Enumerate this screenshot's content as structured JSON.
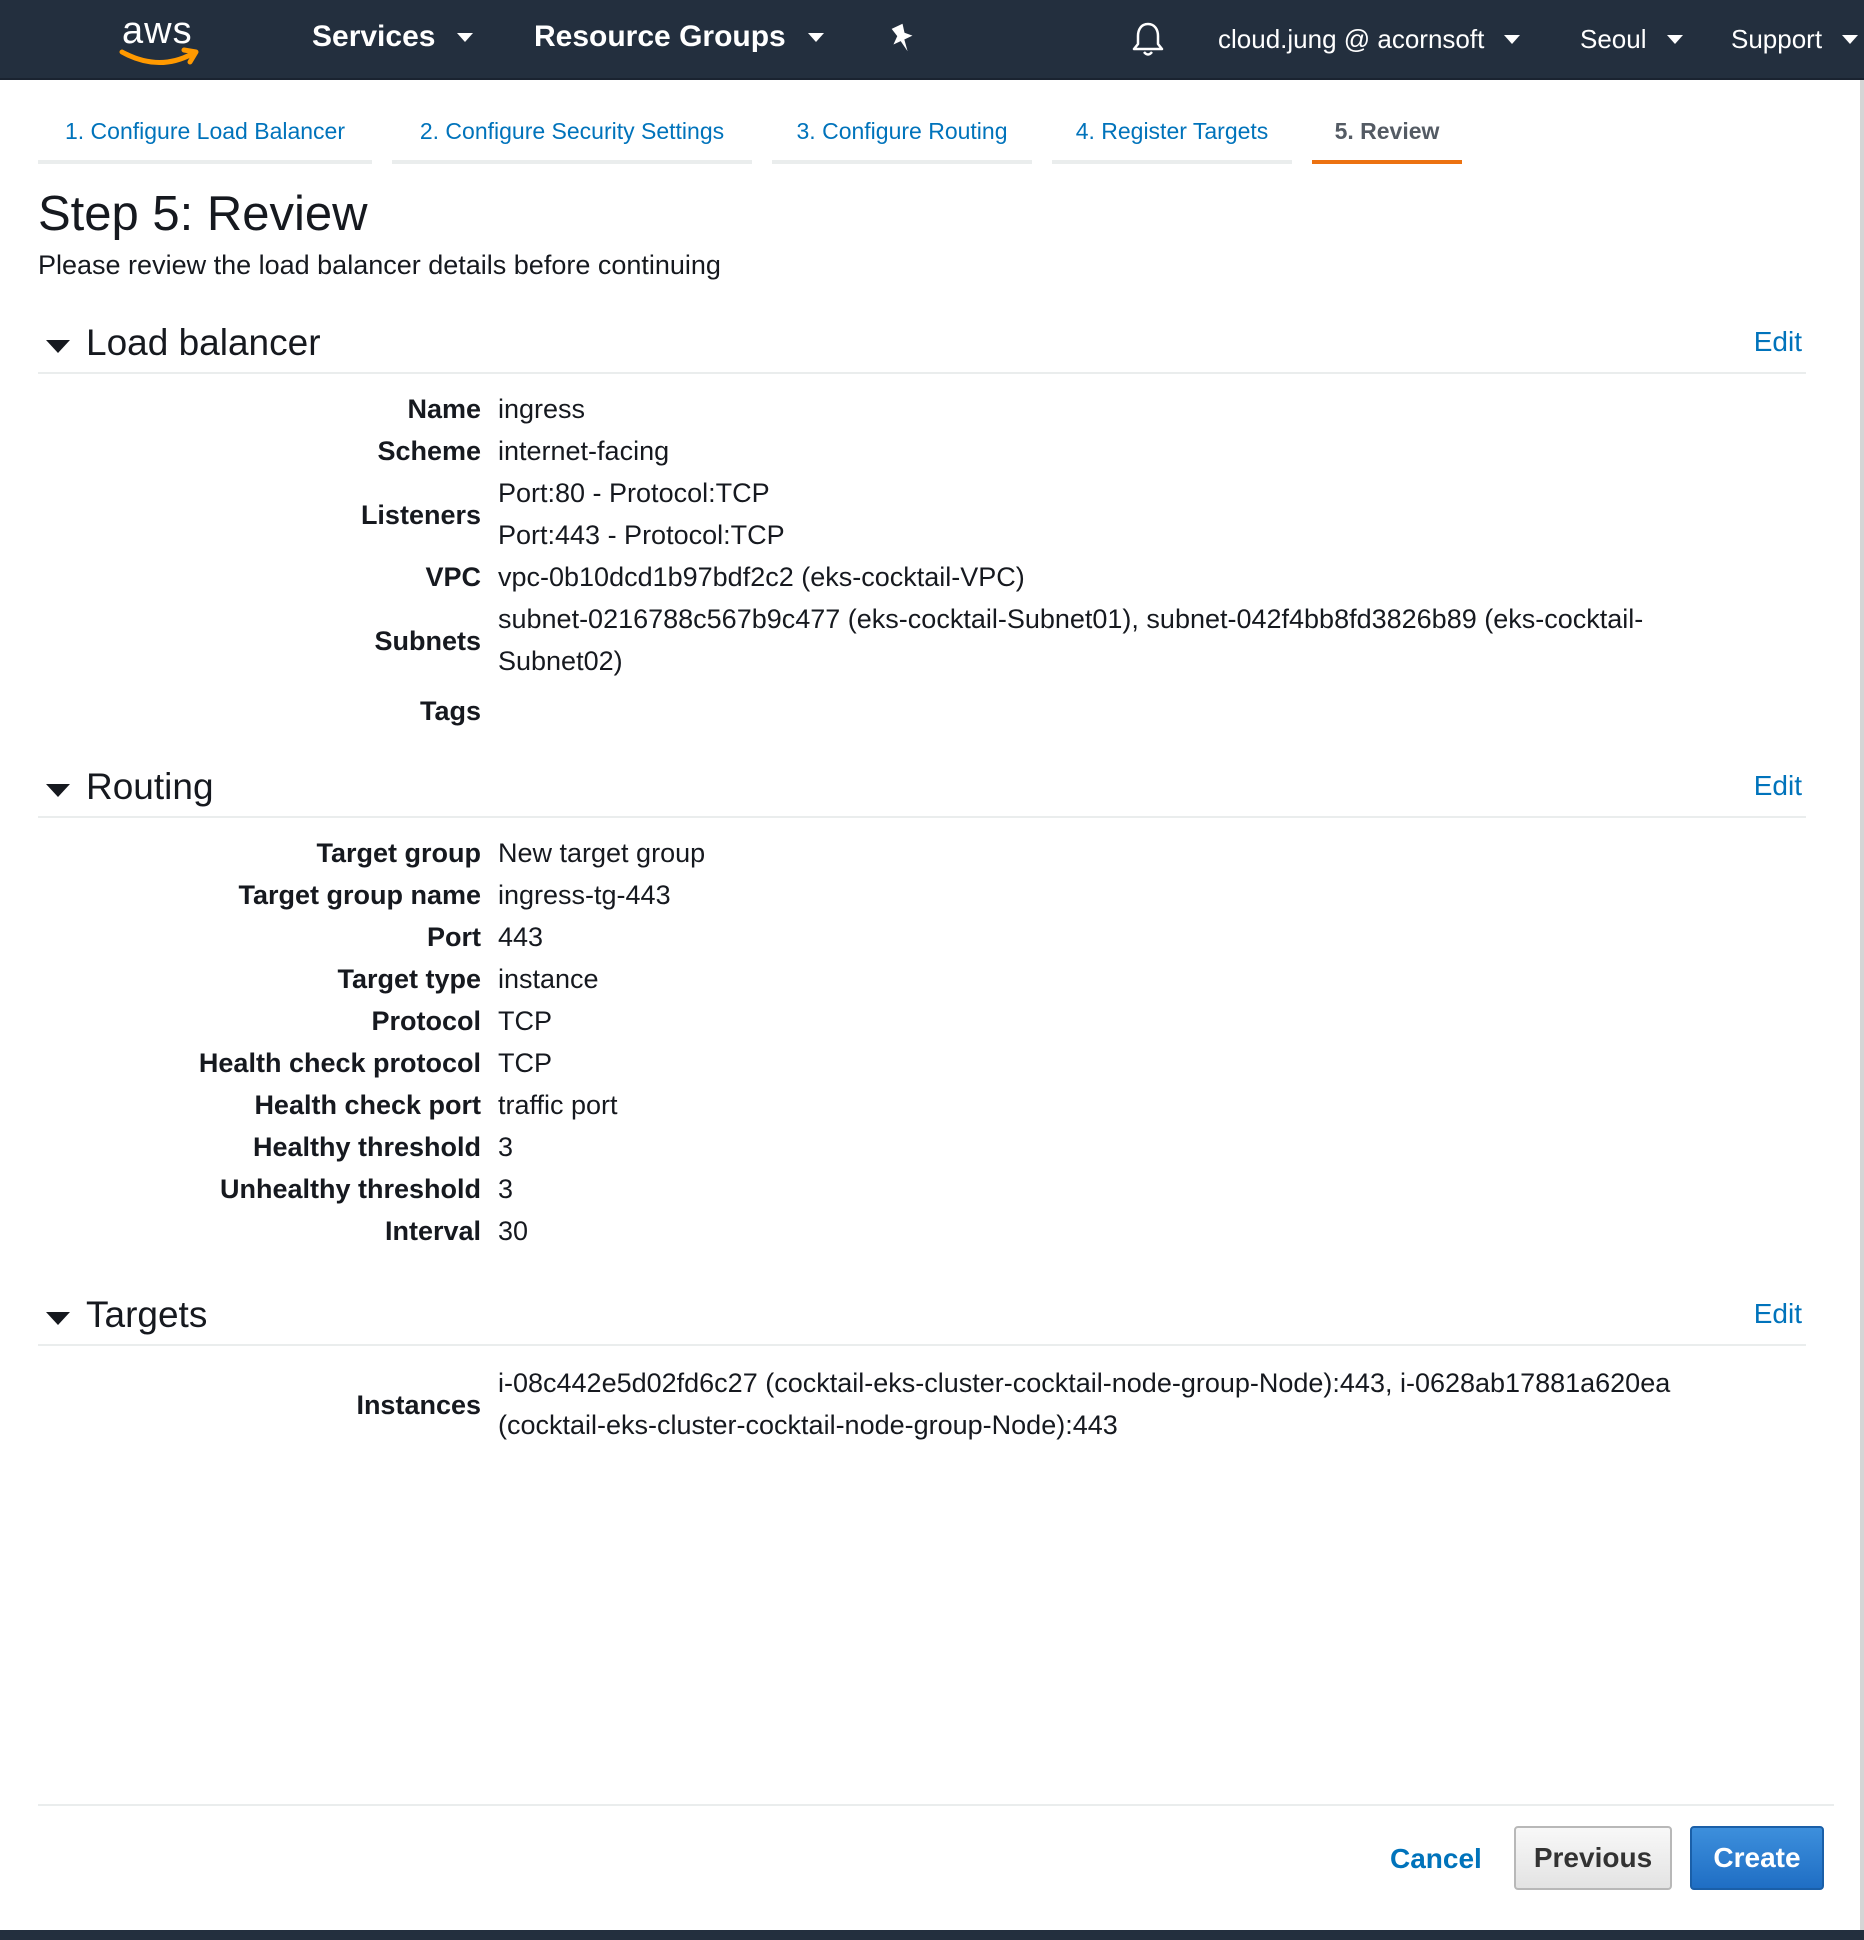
{
  "nav": {
    "logo": "aws",
    "services": "Services",
    "resource_groups": "Resource Groups",
    "pin_icon": "pin-icon",
    "bell_icon": "bell-icon",
    "account": "cloud.jung @ acornsoft",
    "region": "Seoul",
    "support": "Support"
  },
  "tabs": [
    {
      "label": "1. Configure Load Balancer"
    },
    {
      "label": "2. Configure Security Settings"
    },
    {
      "label": "3. Configure Routing"
    },
    {
      "label": "4. Register Targets"
    },
    {
      "label": "5. Review"
    }
  ],
  "page": {
    "title": "Step 5: Review",
    "subtitle": "Please review the load balancer details before continuing"
  },
  "sections": {
    "load_balancer": {
      "title": "Load balancer",
      "edit": "Edit",
      "fields": {
        "name": {
          "label": "Name",
          "value": "ingress"
        },
        "scheme": {
          "label": "Scheme",
          "value": "internet-facing"
        },
        "listeners": {
          "label": "Listeners",
          "value1": "Port:80 - Protocol:TCP",
          "value2": "Port:443 - Protocol:TCP"
        },
        "vpc": {
          "label": "VPC",
          "value": "vpc-0b10dcd1b97bdf2c2 (eks-cocktail-VPC)"
        },
        "subnets": {
          "label": "Subnets",
          "value": "subnet-0216788c567b9c477 (eks-cocktail-Subnet01), subnet-042f4bb8fd3826b89 (eks-cocktail-Subnet02)"
        },
        "tags": {
          "label": "Tags",
          "value": ""
        }
      }
    },
    "routing": {
      "title": "Routing",
      "edit": "Edit",
      "fields": {
        "target_group": {
          "label": "Target group",
          "value": "New target group"
        },
        "target_group_name": {
          "label": "Target group name",
          "value": "ingress-tg-443"
        },
        "port": {
          "label": "Port",
          "value": "443"
        },
        "target_type": {
          "label": "Target type",
          "value": "instance"
        },
        "protocol": {
          "label": "Protocol",
          "value": "TCP"
        },
        "hc_protocol": {
          "label": "Health check protocol",
          "value": "TCP"
        },
        "hc_port": {
          "label": "Health check port",
          "value": "traffic port"
        },
        "healthy": {
          "label": "Healthy threshold",
          "value": "3"
        },
        "unhealthy": {
          "label": "Unhealthy threshold",
          "value": "3"
        },
        "interval": {
          "label": "Interval",
          "value": "30"
        }
      }
    },
    "targets": {
      "title": "Targets",
      "edit": "Edit",
      "fields": {
        "instances": {
          "label": "Instances",
          "value": "i-08c442e5d02fd6c27 (cocktail-eks-cluster-cocktail-node-group-Node):443, i-0628ab17881a620ea (cocktail-eks-cluster-cocktail-node-group-Node):443"
        }
      }
    }
  },
  "footer": {
    "cancel": "Cancel",
    "previous": "Previous",
    "create": "Create"
  },
  "colors": {
    "nav_bg": "#232f3e",
    "link": "#0073bb",
    "active_tab": "#ec7211",
    "create_button": "#1f6ec4"
  }
}
